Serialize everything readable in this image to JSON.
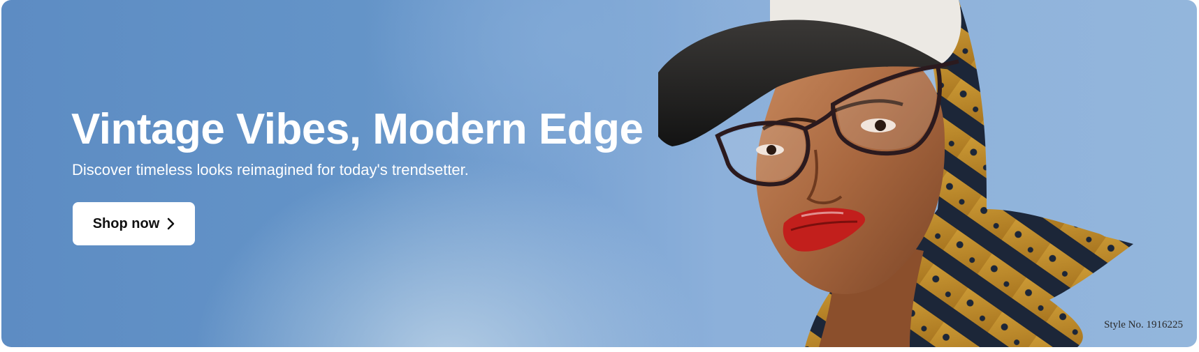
{
  "banner": {
    "headline": "Vintage Vibes, Modern Edge",
    "subtitle": "Discover timeless looks reimagined for today's trendsetter.",
    "cta_label": "Shop now",
    "cta_icon": "chevron-right-icon",
    "style_number": "Style No. 1916225"
  },
  "colors": {
    "sky_blue": "#6494c8",
    "button_bg": "#ffffff",
    "text_light": "#ffffff",
    "lip_red": "#c21f1c",
    "scarf_gold": "#c9952c",
    "scarf_navy": "#1c2638"
  }
}
